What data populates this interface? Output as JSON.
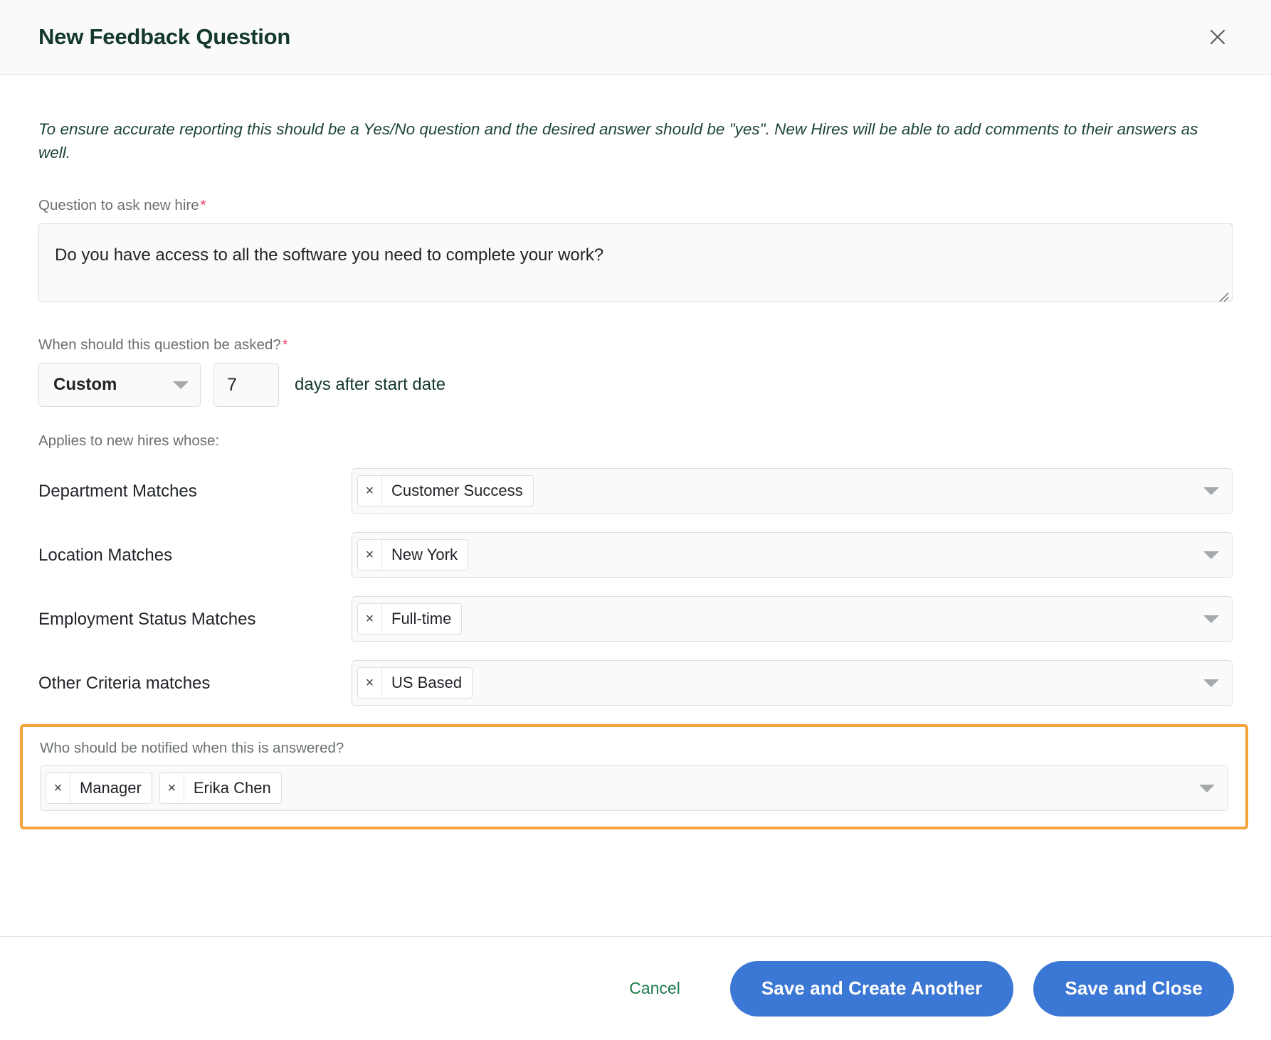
{
  "header": {
    "title": "New Feedback Question",
    "close_icon": "close-icon"
  },
  "body": {
    "intro": "To ensure accurate reporting this should be a Yes/No question and the desired answer should be \"yes\". New Hires will be able to add comments to their answers as well.",
    "question": {
      "label": "Question to ask new hire",
      "required_mark": "*",
      "value": "Do you have access to all the software you need to complete your work?",
      "placeholder": ""
    },
    "timing": {
      "label": "When should this question be asked?",
      "required_mark": "*",
      "select_value": "Custom",
      "days_value": "7",
      "suffix_text": "days after start date",
      "caret_icon": "chevron-down-icon"
    },
    "applies_label": "Applies to new hires whose:",
    "criteria": [
      {
        "label": "Department Matches",
        "chips": [
          {
            "remove_icon": "×",
            "label": "Customer Success"
          }
        ],
        "caret_icon": "chevron-down-icon"
      },
      {
        "label": "Location Matches",
        "chips": [
          {
            "remove_icon": "×",
            "label": "New York"
          }
        ],
        "caret_icon": "chevron-down-icon"
      },
      {
        "label": "Employment Status Matches",
        "chips": [
          {
            "remove_icon": "×",
            "label": "Full-time"
          }
        ],
        "caret_icon": "chevron-down-icon"
      },
      {
        "label": "Other Criteria matches",
        "chips": [
          {
            "remove_icon": "×",
            "label": "US Based"
          }
        ],
        "caret_icon": "chevron-down-icon"
      }
    ],
    "notify": {
      "label": "Who should be notified when this is answered?",
      "chips": [
        {
          "remove_icon": "×",
          "label": "Manager"
        },
        {
          "remove_icon": "×",
          "label": "Erika Chen"
        }
      ],
      "caret_icon": "chevron-down-icon",
      "highlight_color": "#f5a33c"
    }
  },
  "footer": {
    "cancel_label": "Cancel",
    "save_create_label": "Save and Create Another",
    "save_close_label": "Save and Close",
    "primary_color": "#3b77d4",
    "cancel_color": "#1e7a4a"
  }
}
